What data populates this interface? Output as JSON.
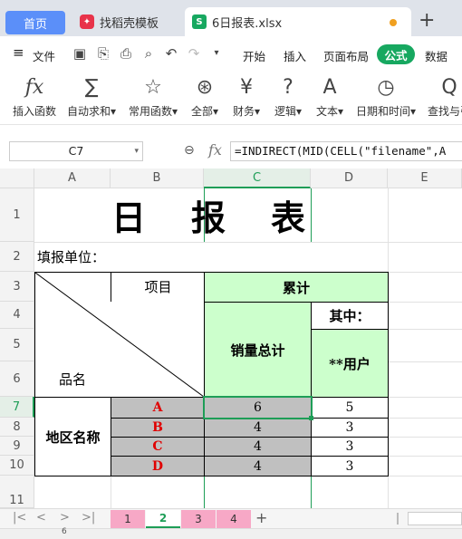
{
  "tabs": {
    "home": "首页",
    "template": "找稻壳模板",
    "file": "6日报表.xlsx",
    "add": "+"
  },
  "menu": {
    "hamburger": "≡",
    "file": "文件",
    "items": [
      "开始",
      "插入",
      "页面布局",
      "公式",
      "数据"
    ]
  },
  "ribbon": [
    {
      "glyph": "fx",
      "label": "插入函数"
    },
    {
      "glyph": "∑",
      "label": "自动求和▾"
    },
    {
      "glyph": "☆",
      "label": "常用函数▾"
    },
    {
      "glyph": "⊛",
      "label": "全部▾"
    },
    {
      "glyph": "¥",
      "label": "财务▾"
    },
    {
      "glyph": "?",
      "label": "逻辑▾"
    },
    {
      "glyph": "A",
      "label": "文本▾"
    },
    {
      "glyph": "◷",
      "label": "日期和时间▾"
    },
    {
      "glyph": "Q",
      "label": "查找与引"
    }
  ],
  "formula_bar": {
    "cell_ref": "C7",
    "fx": "fx",
    "formula": "=INDIRECT(MID(CELL(\"filename\",A"
  },
  "columns": [
    "A",
    "B",
    "C",
    "D",
    "E"
  ],
  "rows": [
    "1",
    "2",
    "3",
    "4",
    "5",
    "6",
    "7",
    "8",
    "9",
    "10",
    "11"
  ],
  "sheet": {
    "title": "日　报　表",
    "unit_label": "填报单位：",
    "item_header": "项目",
    "cumulative_header": "累计",
    "of_which": "其中：",
    "sales_total": "销量总计",
    "users": "**用户",
    "name_label": "品名",
    "region_label": "地区名称",
    "data": [
      {
        "item": "A",
        "total": "6",
        "users": "5"
      },
      {
        "item": "B",
        "total": "4",
        "users": "3"
      },
      {
        "item": "C",
        "total": "4",
        "users": "3"
      },
      {
        "item": "D",
        "total": "4",
        "users": "3"
      }
    ]
  },
  "sheet_tabs": [
    "1",
    "2",
    "3",
    "4"
  ],
  "active_sheet": "2",
  "nav": {
    "first": "|<",
    "prev": "<",
    "next": ">",
    "last": ">|",
    "add": "+"
  },
  "status": {
    "text": "6"
  },
  "colors": {
    "accent": "#1e9e57",
    "header_fill": "#ccffcc",
    "gray_fill": "#c0c0c0",
    "red_text": "#e00000",
    "tab_pink": "#f7a8c6"
  }
}
